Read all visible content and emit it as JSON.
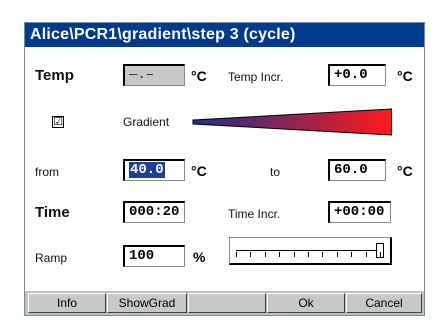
{
  "window": {
    "title": "Alice\\PCR1\\gradient\\step 3 (cycle)"
  },
  "temp": {
    "label": "Temp",
    "value": "—.–",
    "unit": "°C",
    "incr_label": "Temp Incr.",
    "incr_value": "+0.0",
    "incr_unit": "°C"
  },
  "gradient": {
    "checked": true,
    "check_glyph": "☑",
    "label": "Gradient",
    "colors": {
      "start": "#1d2f8a",
      "end": "#ff1a1a"
    }
  },
  "range": {
    "from_label": "from",
    "from_value": "40.0",
    "from_unit": "°C",
    "to_label": "to",
    "to_value": "60.0",
    "to_unit": "°C"
  },
  "time": {
    "label": "Time",
    "value": "000:20",
    "incr_label": "Time Incr.",
    "incr_value": "+00:00"
  },
  "ramp": {
    "label": "Ramp",
    "value": "100",
    "unit": "%",
    "slider_fraction": 1.0
  },
  "buttons": {
    "info": "Info",
    "showgrad": "ShowGrad",
    "blank": "",
    "ok": "Ok",
    "cancel": "Cancel"
  }
}
